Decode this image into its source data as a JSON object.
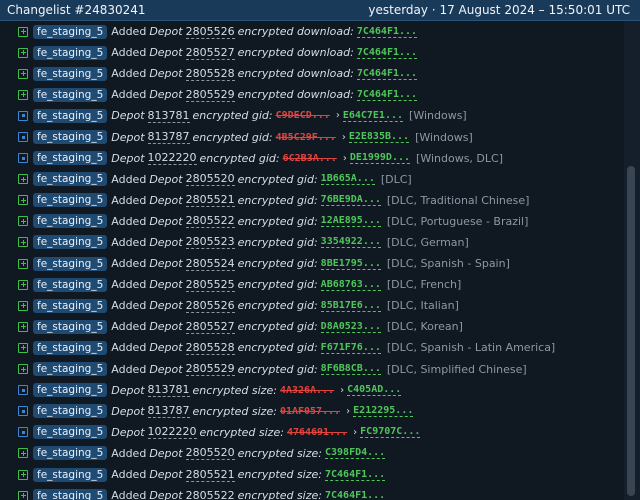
{
  "header": {
    "title": "Changelist #24830241",
    "date": "yesterday · 17 August 2024 – 15:50:01 UTC"
  },
  "rows": [
    {
      "type": "add",
      "tag": "fe_staging_5",
      "action": "Added",
      "depot": "Depot",
      "id": "2805526",
      "field": "encrypted download:",
      "new": "7C464F1...",
      "extra": ""
    },
    {
      "type": "add",
      "tag": "fe_staging_5",
      "action": "Added",
      "depot": "Depot",
      "id": "2805527",
      "field": "encrypted download:",
      "new": "7C464F1...",
      "extra": ""
    },
    {
      "type": "add",
      "tag": "fe_staging_5",
      "action": "Added",
      "depot": "Depot",
      "id": "2805528",
      "field": "encrypted download:",
      "new": "7C464F1...",
      "extra": ""
    },
    {
      "type": "add",
      "tag": "fe_staging_5",
      "action": "Added",
      "depot": "Depot",
      "id": "2805529",
      "field": "encrypted download:",
      "new": "7C464F1...",
      "extra": ""
    },
    {
      "type": "mod",
      "tag": "fe_staging_5",
      "depot": "Depot",
      "id": "813781",
      "field": "encrypted gid:",
      "old": "C9DECD...",
      "arrow": "›",
      "new": "E64C7E1...",
      "extra": "[Windows]"
    },
    {
      "type": "mod",
      "tag": "fe_staging_5",
      "depot": "Depot",
      "id": "813787",
      "field": "encrypted gid:",
      "old": "4B5C29F...",
      "arrow": "›",
      "new": "E2E835B...",
      "extra": "[Windows]"
    },
    {
      "type": "mod",
      "tag": "fe_staging_5",
      "depot": "Depot",
      "id": "1022220",
      "field": "encrypted gid:",
      "old": "6C2B3A...",
      "arrow": "›",
      "new": "DE1999D...",
      "extra": "[Windows, DLC]"
    },
    {
      "type": "add",
      "tag": "fe_staging_5",
      "action": "Added",
      "depot": "Depot",
      "id": "2805520",
      "field": "encrypted gid:",
      "new": "1B665A...",
      "extra": "[DLC]"
    },
    {
      "type": "add",
      "tag": "fe_staging_5",
      "action": "Added",
      "depot": "Depot",
      "id": "2805521",
      "field": "encrypted gid:",
      "new": "76BE9DA...",
      "extra": "[DLC, Traditional Chinese]"
    },
    {
      "type": "add",
      "tag": "fe_staging_5",
      "action": "Added",
      "depot": "Depot",
      "id": "2805522",
      "field": "encrypted gid:",
      "new": "12AE895...",
      "extra": "[DLC, Portuguese - Brazil]"
    },
    {
      "type": "add",
      "tag": "fe_staging_5",
      "action": "Added",
      "depot": "Depot",
      "id": "2805523",
      "field": "encrypted gid:",
      "new": "3354922...",
      "extra": "[DLC, German]"
    },
    {
      "type": "add",
      "tag": "fe_staging_5",
      "action": "Added",
      "depot": "Depot",
      "id": "2805524",
      "field": "encrypted gid:",
      "new": "8BE1795...",
      "extra": "[DLC, Spanish - Spain]"
    },
    {
      "type": "add",
      "tag": "fe_staging_5",
      "action": "Added",
      "depot": "Depot",
      "id": "2805525",
      "field": "encrypted gid:",
      "new": "AB68763...",
      "extra": "[DLC, French]"
    },
    {
      "type": "add",
      "tag": "fe_staging_5",
      "action": "Added",
      "depot": "Depot",
      "id": "2805526",
      "field": "encrypted gid:",
      "new": "85B17E6...",
      "extra": "[DLC, Italian]"
    },
    {
      "type": "add",
      "tag": "fe_staging_5",
      "action": "Added",
      "depot": "Depot",
      "id": "2805527",
      "field": "encrypted gid:",
      "new": "D8A0523...",
      "extra": "[DLC, Korean]"
    },
    {
      "type": "add",
      "tag": "fe_staging_5",
      "action": "Added",
      "depot": "Depot",
      "id": "2805528",
      "field": "encrypted gid:",
      "new": "F671F76...",
      "extra": "[DLC, Spanish - Latin America]"
    },
    {
      "type": "add",
      "tag": "fe_staging_5",
      "action": "Added",
      "depot": "Depot",
      "id": "2805529",
      "field": "encrypted gid:",
      "new": "8F6B8CB...",
      "extra": "[DLC, Simplified Chinese]"
    },
    {
      "type": "mod",
      "tag": "fe_staging_5",
      "depot": "Depot",
      "id": "813781",
      "field": "encrypted size:",
      "old": "4A326A...",
      "arrow": "›",
      "new": "C405AD...",
      "extra": ""
    },
    {
      "type": "mod",
      "tag": "fe_staging_5",
      "depot": "Depot",
      "id": "813787",
      "field": "encrypted size:",
      "old": "01AF057...",
      "arrow": "›",
      "new": "E212295...",
      "extra": ""
    },
    {
      "type": "mod",
      "tag": "fe_staging_5",
      "depot": "Depot",
      "id": "1022220",
      "field": "encrypted size:",
      "old": "4764691...",
      "arrow": "›",
      "new": "FC9707C...",
      "extra": ""
    },
    {
      "type": "add",
      "tag": "fe_staging_5",
      "action": "Added",
      "depot": "Depot",
      "id": "2805520",
      "field": "encrypted size:",
      "new": "C398FD4...",
      "extra": ""
    },
    {
      "type": "add",
      "tag": "fe_staging_5",
      "action": "Added",
      "depot": "Depot",
      "id": "2805521",
      "field": "encrypted size:",
      "new": "7C464F1...",
      "extra": ""
    },
    {
      "type": "add",
      "tag": "fe_staging_5",
      "action": "Added",
      "depot": "Depot",
      "id": "2805522",
      "field": "encrypted size:",
      "new": "7C464F1...",
      "extra": ""
    }
  ],
  "icons": {
    "add": "plus-square-icon",
    "mod": "modified-square-icon"
  },
  "colors": {
    "header_bg": "#1a3a5a",
    "tag_bg": "#1f4a72",
    "new_value": "#4fc65a",
    "old_value": "#e0443e"
  }
}
